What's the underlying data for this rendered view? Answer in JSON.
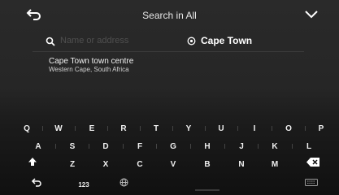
{
  "header": {
    "title": "Search in All",
    "back_icon": "back-arrow-icon",
    "collapse_icon": "chevron-down-icon"
  },
  "search": {
    "placeholder": "Name or address",
    "value": "",
    "city": "Cape Town"
  },
  "results": [
    {
      "title": "Cape Town town centre",
      "subtitle": "Western Cape, South Africa"
    }
  ],
  "keyboard": {
    "row1": [
      "Q",
      "W",
      "E",
      "R",
      "T",
      "Y",
      "U",
      "I",
      "O",
      "P"
    ],
    "row2": [
      "A",
      "S",
      "D",
      "F",
      "G",
      "H",
      "J",
      "K",
      "L"
    ],
    "row3": [
      "Z",
      "X",
      "C",
      "V",
      "B",
      "N",
      "M"
    ],
    "numbers_label": "123",
    "shift_icon": "shift-arrow-icon",
    "backspace_icon": "backspace-icon",
    "return_icon": "return-arrow-icon",
    "globe_icon": "globe-icon",
    "hide_keyboard_icon": "keyboard-hide-icon"
  }
}
